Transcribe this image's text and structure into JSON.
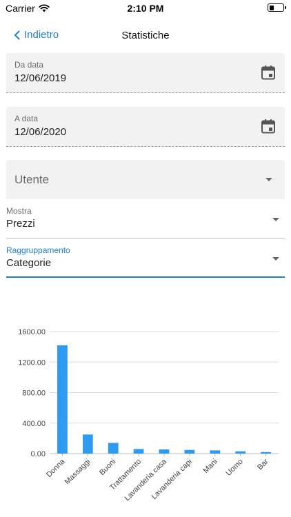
{
  "status_bar": {
    "carrier": "Carrier",
    "time": "2:10 PM",
    "battery_level": 0.35
  },
  "nav": {
    "back_label": "Indietro",
    "title": "Statistiche"
  },
  "from_date": {
    "label": "Da data",
    "value": "12/06/2019",
    "icon": "calendar-icon"
  },
  "to_date": {
    "label": "A data",
    "value": "12/06/2020",
    "icon": "calendar-icon"
  },
  "user_select": {
    "placeholder": "Utente"
  },
  "show_select": {
    "label": "Mostra",
    "value": "Prezzi"
  },
  "grouping_select": {
    "label": "Raggruppamento",
    "value": "Categorie"
  },
  "colors": {
    "accent": "#1f7ed1",
    "bar": "#2f9bf0"
  },
  "chart_data": {
    "type": "bar",
    "categories": [
      "Donna",
      "Massaggi",
      "Buoni",
      "Trattamento",
      "Lavanderia casa",
      "Lavanderia capi",
      "Mani",
      "Uomo",
      "Bar"
    ],
    "values": [
      1420,
      250,
      140,
      60,
      55,
      48,
      42,
      30,
      20
    ],
    "y_ticks": [
      "0.00",
      "400.00",
      "800.00",
      "1200.00",
      "1600.00"
    ],
    "ylim": [
      0,
      1600
    ],
    "grid": true,
    "legend": "none"
  }
}
